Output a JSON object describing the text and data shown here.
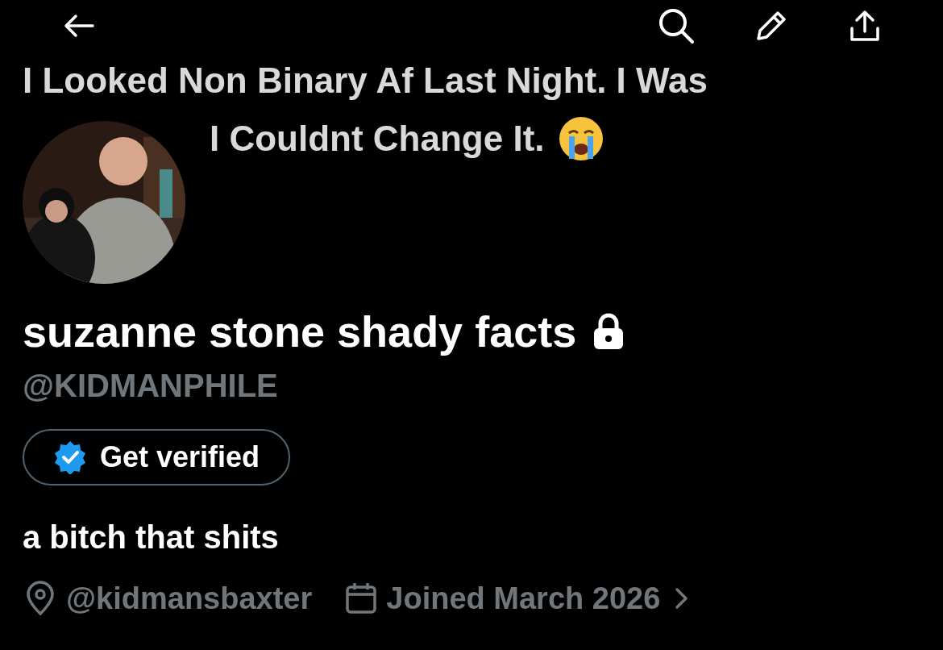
{
  "banner": {
    "lines": [
      "I Looked Non Binary Af Last Night. I Was",
      "I Couldnt Change It."
    ]
  },
  "profile": {
    "name": "suzanne stone shady facts",
    "protected": true,
    "handle": "@KIDMANPHILE",
    "verify_button": "Get verified",
    "bio": "a bitch that shits",
    "location": "@kidmansbaxter",
    "joined": "Joined March 2026"
  }
}
